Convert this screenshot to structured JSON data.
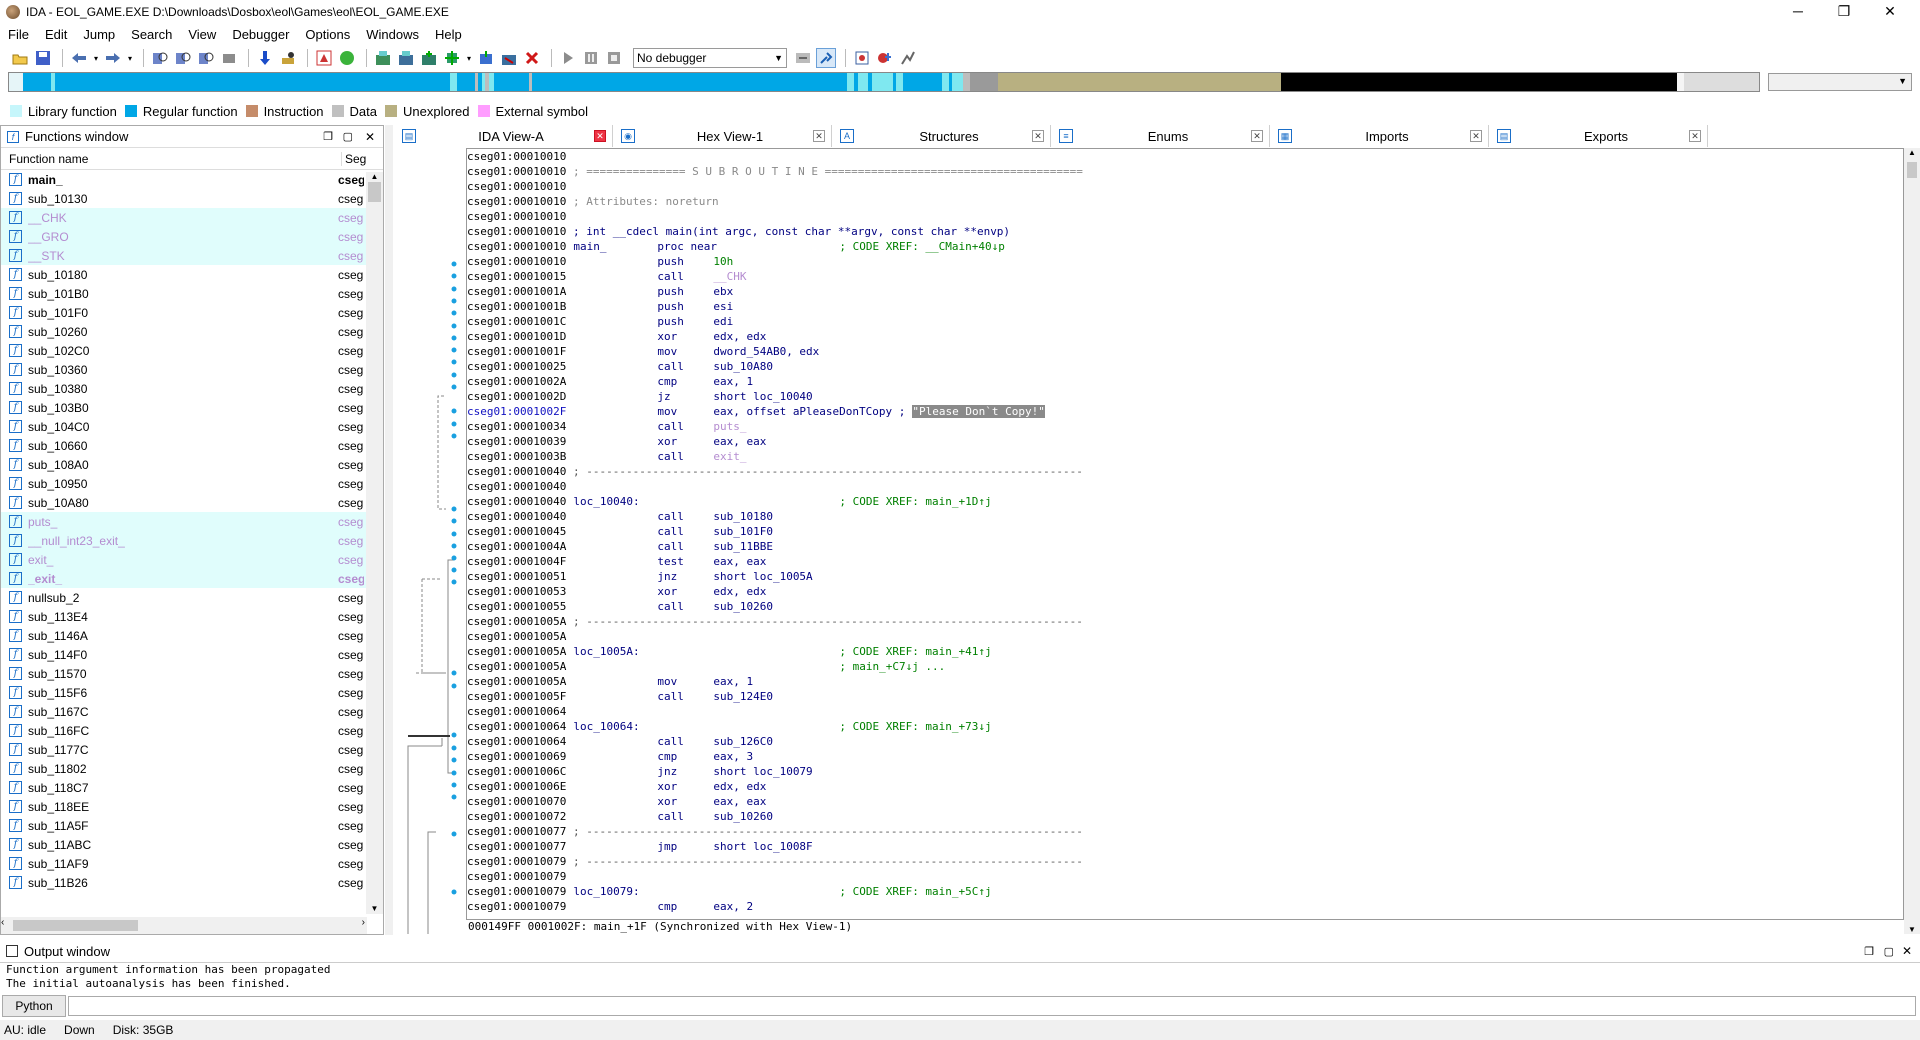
{
  "window": {
    "title": "IDA - EOL_GAME.EXE D:\\Downloads\\Dosbox\\eol\\Games\\eol\\EOL_GAME.EXE",
    "minimize": "─",
    "maximize": "❐",
    "close": "✕"
  },
  "menu": [
    "File",
    "Edit",
    "Jump",
    "Search",
    "View",
    "Debugger",
    "Options",
    "Windows",
    "Help"
  ],
  "toolbar": {
    "debugger": "No debugger"
  },
  "navband_colors": {
    "regular": "#00a7e6",
    "library": "#7fe8f0",
    "data": "#bdbdbd",
    "unexplored": "#b8b081",
    "external": "#000000"
  },
  "legend": [
    {
      "label": "Library function",
      "color": "#c6f6fb"
    },
    {
      "label": "Regular function",
      "color": "#00a7e6"
    },
    {
      "label": "Instruction",
      "color": "#c58c6a"
    },
    {
      "label": "Data",
      "color": "#c0c0c0"
    },
    {
      "label": "Unexplored",
      "color": "#b8b081"
    },
    {
      "label": "External symbol",
      "color": "#ff9dff"
    }
  ],
  "functions_window": {
    "title": "Functions window",
    "col_name": "Function name",
    "col_seg": "Seg",
    "rows": [
      {
        "name": "main_",
        "seg": "cseg",
        "lib": false,
        "bold": true
      },
      {
        "name": "sub_10130",
        "seg": "cseg",
        "lib": false,
        "bold": false
      },
      {
        "name": "__CHK",
        "seg": "cseg",
        "lib": true,
        "bold": false
      },
      {
        "name": "__GRO",
        "seg": "cseg",
        "lib": true,
        "bold": false
      },
      {
        "name": "__STK",
        "seg": "cseg",
        "lib": true,
        "bold": false
      },
      {
        "name": "sub_10180",
        "seg": "cseg",
        "lib": false,
        "bold": false
      },
      {
        "name": "sub_101B0",
        "seg": "cseg",
        "lib": false,
        "bold": false
      },
      {
        "name": "sub_101F0",
        "seg": "cseg",
        "lib": false,
        "bold": false
      },
      {
        "name": "sub_10260",
        "seg": "cseg",
        "lib": false,
        "bold": false
      },
      {
        "name": "sub_102C0",
        "seg": "cseg",
        "lib": false,
        "bold": false
      },
      {
        "name": "sub_10360",
        "seg": "cseg",
        "lib": false,
        "bold": false
      },
      {
        "name": "sub_10380",
        "seg": "cseg",
        "lib": false,
        "bold": false
      },
      {
        "name": "sub_103B0",
        "seg": "cseg",
        "lib": false,
        "bold": false
      },
      {
        "name": "sub_104C0",
        "seg": "cseg",
        "lib": false,
        "bold": false
      },
      {
        "name": "sub_10660",
        "seg": "cseg",
        "lib": false,
        "bold": false
      },
      {
        "name": "sub_108A0",
        "seg": "cseg",
        "lib": false,
        "bold": false
      },
      {
        "name": "sub_10950",
        "seg": "cseg",
        "lib": false,
        "bold": false
      },
      {
        "name": "sub_10A80",
        "seg": "cseg",
        "lib": false,
        "bold": false
      },
      {
        "name": "puts_",
        "seg": "cseg",
        "lib": true,
        "bold": false
      },
      {
        "name": "__null_int23_exit_",
        "seg": "cseg",
        "lib": true,
        "bold": false
      },
      {
        "name": "exit_",
        "seg": "cseg",
        "lib": true,
        "bold": false
      },
      {
        "name": "_exit_",
        "seg": "cseg",
        "lib": true,
        "bold": true
      },
      {
        "name": "nullsub_2",
        "seg": "cseg",
        "lib": false,
        "bold": false
      },
      {
        "name": "sub_113E4",
        "seg": "cseg",
        "lib": false,
        "bold": false
      },
      {
        "name": "sub_1146A",
        "seg": "cseg",
        "lib": false,
        "bold": false
      },
      {
        "name": "sub_114F0",
        "seg": "cseg",
        "lib": false,
        "bold": false
      },
      {
        "name": "sub_11570",
        "seg": "cseg",
        "lib": false,
        "bold": false
      },
      {
        "name": "sub_115F6",
        "seg": "cseg",
        "lib": false,
        "bold": false
      },
      {
        "name": "sub_1167C",
        "seg": "cseg",
        "lib": false,
        "bold": false
      },
      {
        "name": "sub_116FC",
        "seg": "cseg",
        "lib": false,
        "bold": false
      },
      {
        "name": "sub_1177C",
        "seg": "cseg",
        "lib": false,
        "bold": false
      },
      {
        "name": "sub_11802",
        "seg": "cseg",
        "lib": false,
        "bold": false
      },
      {
        "name": "sub_118C7",
        "seg": "cseg",
        "lib": false,
        "bold": false
      },
      {
        "name": "sub_118EE",
        "seg": "cseg",
        "lib": false,
        "bold": false
      },
      {
        "name": "sub_11A5F",
        "seg": "cseg",
        "lib": false,
        "bold": false
      },
      {
        "name": "sub_11ABC",
        "seg": "cseg",
        "lib": false,
        "bold": false
      },
      {
        "name": "sub_11AF9",
        "seg": "cseg",
        "lib": false,
        "bold": false
      },
      {
        "name": "sub_11B26",
        "seg": "cseg",
        "lib": false,
        "bold": false
      }
    ]
  },
  "tabs": [
    {
      "label": "IDA View-A",
      "active": true
    },
    {
      "label": "Hex View-1",
      "active": false
    },
    {
      "label": "Structures",
      "active": false
    },
    {
      "label": "Enums",
      "active": false
    },
    {
      "label": "Imports",
      "active": false
    },
    {
      "label": "Exports",
      "active": false
    }
  ],
  "disasm": [
    {
      "a": "cseg01:00010010",
      "t": ""
    },
    {
      "a": "cseg01:00010010",
      "t": " ; =============== S U B R O U T I N E =======================================",
      "c": "gray"
    },
    {
      "a": "cseg01:00010010",
      "t": ""
    },
    {
      "a": "cseg01:00010010",
      "t": " ; Attributes: noreturn",
      "c": "gray"
    },
    {
      "a": "cseg01:00010010",
      "t": ""
    },
    {
      "a": "cseg01:00010010",
      "t": " ; int __cdecl main(int argc, const char **argv, const char **envp)",
      "c": "lbl"
    },
    {
      "a": "cseg01:00010010",
      "lb": "main_",
      "m": "proc near",
      "o": "",
      "cm": "; CODE XREF: __CMain+40↓p"
    },
    {
      "a": "cseg01:00010010",
      "m": "push",
      "o": "10h",
      "oc": "num"
    },
    {
      "a": "cseg01:00010015",
      "m": "call",
      "o": "__CHK",
      "oc": "lib"
    },
    {
      "a": "cseg01:0001001A",
      "m": "push",
      "o": "ebx"
    },
    {
      "a": "cseg01:0001001B",
      "m": "push",
      "o": "esi"
    },
    {
      "a": "cseg01:0001001C",
      "m": "push",
      "o": "edi"
    },
    {
      "a": "cseg01:0001001D",
      "m": "xor",
      "o": "edx, edx"
    },
    {
      "a": "cseg01:0001001F",
      "m": "mov",
      "o": "dword_54AB0, edx"
    },
    {
      "a": "cseg01:00010025",
      "m": "call",
      "o": "sub_10A80"
    },
    {
      "a": "cseg01:0001002A",
      "m": "cmp",
      "o": "eax, 1"
    },
    {
      "a": "cseg01:0001002D",
      "m": "jz",
      "o": "short loc_10040"
    },
    {
      "a": "cseg01:0001002F",
      "m": "mov",
      "o": "eax, offset aPleaseDonTCopy ;",
      "s": "\"Please Don`t Copy!\"",
      "sel": true
    },
    {
      "a": "cseg01:00010034",
      "m": "call",
      "o": "puts_",
      "oc": "lib"
    },
    {
      "a": "cseg01:00010039",
      "m": "xor",
      "o": "eax, eax"
    },
    {
      "a": "cseg01:0001003B",
      "m": "call",
      "o": "exit_",
      "oc": "lib"
    },
    {
      "a": "cseg01:00010040",
      "t": " ; ---------------------------------------------------------------------------",
      "c": "sep"
    },
    {
      "a": "cseg01:00010040",
      "t": ""
    },
    {
      "a": "cseg01:00010040",
      "lb": "loc_10040:",
      "m": "",
      "o": "",
      "cm": "; CODE XREF: main_+1D↑j"
    },
    {
      "a": "cseg01:00010040",
      "m": "call",
      "o": "sub_10180"
    },
    {
      "a": "cseg01:00010045",
      "m": "call",
      "o": "sub_101F0"
    },
    {
      "a": "cseg01:0001004A",
      "m": "call",
      "o": "sub_11BBE"
    },
    {
      "a": "cseg01:0001004F",
      "m": "test",
      "o": "eax, eax"
    },
    {
      "a": "cseg01:00010051",
      "m": "jnz",
      "o": "short loc_1005A"
    },
    {
      "a": "cseg01:00010053",
      "m": "xor",
      "o": "edx, edx"
    },
    {
      "a": "cseg01:00010055",
      "m": "call",
      "o": "sub_10260"
    },
    {
      "a": "cseg01:0001005A",
      "t": " ; ---------------------------------------------------------------------------",
      "c": "sep"
    },
    {
      "a": "cseg01:0001005A",
      "t": ""
    },
    {
      "a": "cseg01:0001005A",
      "lb": "loc_1005A:",
      "m": "",
      "o": "",
      "cm": "; CODE XREF: main_+41↑j"
    },
    {
      "a": "cseg01:0001005A",
      "m": "",
      "o": "",
      "cm": "; main_+C7↓j ..."
    },
    {
      "a": "cseg01:0001005A",
      "m": "mov",
      "o": "eax, 1"
    },
    {
      "a": "cseg01:0001005F",
      "m": "call",
      "o": "sub_124E0"
    },
    {
      "a": "cseg01:00010064",
      "t": ""
    },
    {
      "a": "cseg01:00010064",
      "lb": "loc_10064:",
      "m": "",
      "o": "",
      "cm": "; CODE XREF: main_+73↓j"
    },
    {
      "a": "cseg01:00010064",
      "m": "call",
      "o": "sub_126C0"
    },
    {
      "a": "cseg01:00010069",
      "m": "cmp",
      "o": "eax, 3"
    },
    {
      "a": "cseg01:0001006C",
      "m": "jnz",
      "o": "short loc_10079"
    },
    {
      "a": "cseg01:0001006E",
      "m": "xor",
      "o": "edx, edx"
    },
    {
      "a": "cseg01:00010070",
      "m": "xor",
      "o": "eax, eax"
    },
    {
      "a": "cseg01:00010072",
      "m": "call",
      "o": "sub_10260"
    },
    {
      "a": "cseg01:00010077",
      "t": " ; ---------------------------------------------------------------------------",
      "c": "sep"
    },
    {
      "a": "cseg01:00010077",
      "m": "jmp",
      "o": "short loc_1008F"
    },
    {
      "a": "cseg01:00010079",
      "t": " ; ---------------------------------------------------------------------------",
      "c": "sep"
    },
    {
      "a": "cseg01:00010079",
      "t": ""
    },
    {
      "a": "cseg01:00010079",
      "lb": "loc_10079:",
      "m": "",
      "o": "",
      "cm": "; CODE XREF: main_+5C↑j"
    },
    {
      "a": "cseg01:00010079",
      "m": "cmp",
      "o": "eax, 2"
    }
  ],
  "disasm_status": "000149FF 0001002F: main_+1F (Synchronized with Hex View-1)",
  "output": {
    "title": "Output window",
    "lines": [
      "Function argument information has been propagated",
      "The initial autoanalysis has been finished."
    ]
  },
  "python_button": "Python",
  "status": {
    "au": "AU:  idle",
    "dir": "Down",
    "disk": "Disk: 35GB"
  }
}
